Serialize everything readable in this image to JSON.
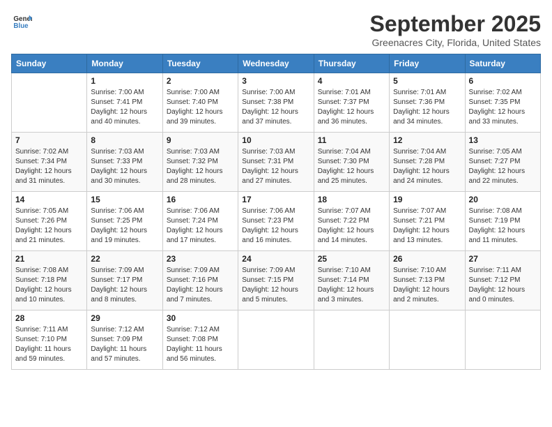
{
  "header": {
    "logo_line1": "General",
    "logo_line2": "Blue",
    "month": "September 2025",
    "location": "Greenacres City, Florida, United States"
  },
  "weekdays": [
    "Sunday",
    "Monday",
    "Tuesday",
    "Wednesday",
    "Thursday",
    "Friday",
    "Saturday"
  ],
  "weeks": [
    [
      {
        "day": "",
        "info": ""
      },
      {
        "day": "1",
        "info": "Sunrise: 7:00 AM\nSunset: 7:41 PM\nDaylight: 12 hours\nand 40 minutes."
      },
      {
        "day": "2",
        "info": "Sunrise: 7:00 AM\nSunset: 7:40 PM\nDaylight: 12 hours\nand 39 minutes."
      },
      {
        "day": "3",
        "info": "Sunrise: 7:00 AM\nSunset: 7:38 PM\nDaylight: 12 hours\nand 37 minutes."
      },
      {
        "day": "4",
        "info": "Sunrise: 7:01 AM\nSunset: 7:37 PM\nDaylight: 12 hours\nand 36 minutes."
      },
      {
        "day": "5",
        "info": "Sunrise: 7:01 AM\nSunset: 7:36 PM\nDaylight: 12 hours\nand 34 minutes."
      },
      {
        "day": "6",
        "info": "Sunrise: 7:02 AM\nSunset: 7:35 PM\nDaylight: 12 hours\nand 33 minutes."
      }
    ],
    [
      {
        "day": "7",
        "info": "Sunrise: 7:02 AM\nSunset: 7:34 PM\nDaylight: 12 hours\nand 31 minutes."
      },
      {
        "day": "8",
        "info": "Sunrise: 7:03 AM\nSunset: 7:33 PM\nDaylight: 12 hours\nand 30 minutes."
      },
      {
        "day": "9",
        "info": "Sunrise: 7:03 AM\nSunset: 7:32 PM\nDaylight: 12 hours\nand 28 minutes."
      },
      {
        "day": "10",
        "info": "Sunrise: 7:03 AM\nSunset: 7:31 PM\nDaylight: 12 hours\nand 27 minutes."
      },
      {
        "day": "11",
        "info": "Sunrise: 7:04 AM\nSunset: 7:30 PM\nDaylight: 12 hours\nand 25 minutes."
      },
      {
        "day": "12",
        "info": "Sunrise: 7:04 AM\nSunset: 7:28 PM\nDaylight: 12 hours\nand 24 minutes."
      },
      {
        "day": "13",
        "info": "Sunrise: 7:05 AM\nSunset: 7:27 PM\nDaylight: 12 hours\nand 22 minutes."
      }
    ],
    [
      {
        "day": "14",
        "info": "Sunrise: 7:05 AM\nSunset: 7:26 PM\nDaylight: 12 hours\nand 21 minutes."
      },
      {
        "day": "15",
        "info": "Sunrise: 7:06 AM\nSunset: 7:25 PM\nDaylight: 12 hours\nand 19 minutes."
      },
      {
        "day": "16",
        "info": "Sunrise: 7:06 AM\nSunset: 7:24 PM\nDaylight: 12 hours\nand 17 minutes."
      },
      {
        "day": "17",
        "info": "Sunrise: 7:06 AM\nSunset: 7:23 PM\nDaylight: 12 hours\nand 16 minutes."
      },
      {
        "day": "18",
        "info": "Sunrise: 7:07 AM\nSunset: 7:22 PM\nDaylight: 12 hours\nand 14 minutes."
      },
      {
        "day": "19",
        "info": "Sunrise: 7:07 AM\nSunset: 7:21 PM\nDaylight: 12 hours\nand 13 minutes."
      },
      {
        "day": "20",
        "info": "Sunrise: 7:08 AM\nSunset: 7:19 PM\nDaylight: 12 hours\nand 11 minutes."
      }
    ],
    [
      {
        "day": "21",
        "info": "Sunrise: 7:08 AM\nSunset: 7:18 PM\nDaylight: 12 hours\nand 10 minutes."
      },
      {
        "day": "22",
        "info": "Sunrise: 7:09 AM\nSunset: 7:17 PM\nDaylight: 12 hours\nand 8 minutes."
      },
      {
        "day": "23",
        "info": "Sunrise: 7:09 AM\nSunset: 7:16 PM\nDaylight: 12 hours\nand 7 minutes."
      },
      {
        "day": "24",
        "info": "Sunrise: 7:09 AM\nSunset: 7:15 PM\nDaylight: 12 hours\nand 5 minutes."
      },
      {
        "day": "25",
        "info": "Sunrise: 7:10 AM\nSunset: 7:14 PM\nDaylight: 12 hours\nand 3 minutes."
      },
      {
        "day": "26",
        "info": "Sunrise: 7:10 AM\nSunset: 7:13 PM\nDaylight: 12 hours\nand 2 minutes."
      },
      {
        "day": "27",
        "info": "Sunrise: 7:11 AM\nSunset: 7:12 PM\nDaylight: 12 hours\nand 0 minutes."
      }
    ],
    [
      {
        "day": "28",
        "info": "Sunrise: 7:11 AM\nSunset: 7:10 PM\nDaylight: 11 hours\nand 59 minutes."
      },
      {
        "day": "29",
        "info": "Sunrise: 7:12 AM\nSunset: 7:09 PM\nDaylight: 11 hours\nand 57 minutes."
      },
      {
        "day": "30",
        "info": "Sunrise: 7:12 AM\nSunset: 7:08 PM\nDaylight: 11 hours\nand 56 minutes."
      },
      {
        "day": "",
        "info": ""
      },
      {
        "day": "",
        "info": ""
      },
      {
        "day": "",
        "info": ""
      },
      {
        "day": "",
        "info": ""
      }
    ]
  ]
}
